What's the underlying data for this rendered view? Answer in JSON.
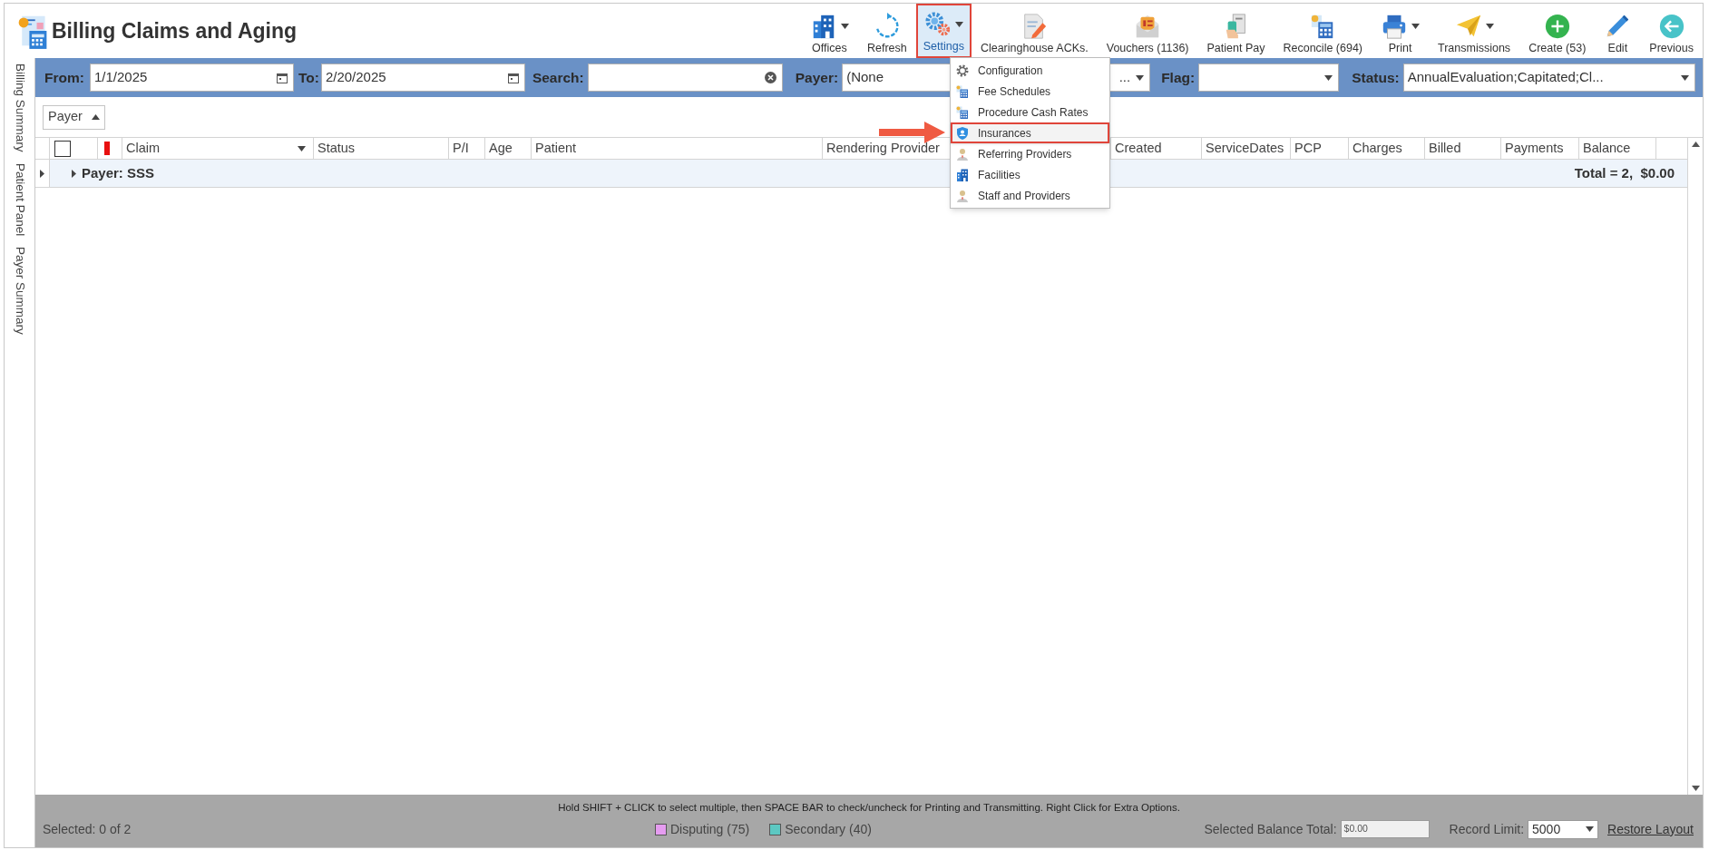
{
  "window": {
    "title": "Billing Claims and Aging"
  },
  "toolbar": [
    {
      "label": "Offices",
      "kind": "building",
      "dropdown": true,
      "selected": false
    },
    {
      "label": "Refresh",
      "kind": "refresh",
      "dropdown": false,
      "selected": false
    },
    {
      "label": "Settings",
      "kind": "gears",
      "dropdown": true,
      "selected": true
    },
    {
      "label": "Clearinghouse ACKs.",
      "kind": "document",
      "dropdown": false,
      "selected": false
    },
    {
      "label": "Vouchers (1136)",
      "kind": "envelope",
      "dropdown": false,
      "selected": false
    },
    {
      "label": "Patient Pay",
      "kind": "payment",
      "dropdown": false,
      "selected": false
    },
    {
      "label": "Reconcile (694)",
      "kind": "calculator",
      "dropdown": false,
      "selected": false
    },
    {
      "label": "Print",
      "kind": "printer",
      "dropdown": true,
      "selected": false
    },
    {
      "label": "Transmissions",
      "kind": "plane",
      "dropdown": true,
      "selected": false
    },
    {
      "label": "Create (53)",
      "kind": "plus",
      "dropdown": false,
      "selected": false
    },
    {
      "label": "Edit",
      "kind": "pencil",
      "dropdown": false,
      "selected": false
    },
    {
      "label": "Previous",
      "kind": "back",
      "dropdown": false,
      "selected": false
    }
  ],
  "side_tabs": [
    {
      "label": "Billing Summary"
    },
    {
      "label": "Patient Panel"
    },
    {
      "label": "Payer Summary"
    }
  ],
  "filters": {
    "from": {
      "label": "From:",
      "value": "1/1/2025"
    },
    "to": {
      "label": "To:",
      "value": "2/20/2025"
    },
    "search": {
      "label": "Search:"
    },
    "payer": {
      "label": "Payer:",
      "value": "(None",
      "tail": "..."
    },
    "flag": {
      "label": "Flag:"
    },
    "status": {
      "label": "Status:",
      "value": "AnnualEvaluation;Capitated;Cl..."
    }
  },
  "group_by": [
    {
      "label": "Payer",
      "ascending": true
    }
  ],
  "table": {
    "columns": [
      {
        "kind": "checkbox",
        "checked": false
      },
      {
        "kind": "flag",
        "color": "#e81010"
      },
      {
        "kind": "dropdown",
        "label": "Claim"
      },
      {
        "kind": "text",
        "label": "Status"
      },
      {
        "kind": "text",
        "label": "P/I"
      },
      {
        "kind": "text",
        "label": "Age"
      },
      {
        "kind": "text",
        "label": "Patient"
      },
      {
        "kind": "text",
        "label": "Rendering Provider"
      },
      {
        "kind": "text",
        "label": "Created"
      },
      {
        "kind": "text",
        "label": "ServiceDates"
      },
      {
        "kind": "text",
        "label": "PCP"
      },
      {
        "kind": "text",
        "label": "Charges"
      },
      {
        "kind": "text",
        "label": "Billed"
      },
      {
        "kind": "text",
        "label": "Payments"
      },
      {
        "kind": "text",
        "label": "Balance"
      }
    ],
    "groups": [
      {
        "label": "Payer: SSS",
        "total": "Total = 2,  $0.00",
        "expanded": false
      }
    ]
  },
  "settings_menu": {
    "items": [
      {
        "label": "Configuration",
        "kind": "gear",
        "selected": false
      },
      {
        "label": "Fee Schedules",
        "kind": "calculator",
        "selected": false
      },
      {
        "label": "Procedure Cash Rates",
        "kind": "calculator",
        "selected": false
      },
      {
        "label": "Insurances",
        "kind": "shield",
        "selected": true
      },
      {
        "label": "Referring Providers",
        "kind": "person",
        "selected": false
      },
      {
        "label": "Facilities",
        "kind": "building",
        "selected": false
      },
      {
        "label": "Staff and Providers",
        "kind": "person",
        "selected": false
      }
    ]
  },
  "status_bar": {
    "hint": "Hold SHIFT + CLICK to select multiple, then SPACE BAR to check/uncheck for Printing and Transmitting. Right Click for Extra Options.",
    "selection": "Selected: 0 of 2",
    "legend": [
      {
        "label": "Disputing",
        "count": "(75)",
        "color": "#e59cf0"
      },
      {
        "label": "Secondary",
        "count": "(40)",
        "color": "#5cc8c2"
      }
    ],
    "balance": {
      "label": "Selected Balance Total:",
      "value": "$0.00"
    },
    "record_limit": {
      "label": "Record Limit:",
      "value": "5000"
    },
    "restore": "Restore Layout"
  }
}
